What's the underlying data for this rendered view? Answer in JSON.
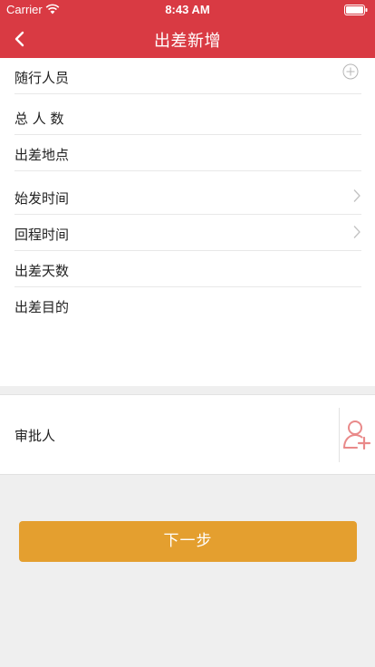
{
  "status_bar": {
    "carrier": "Carrier",
    "time": "8:43 AM",
    "wifi_icon": "wifi-icon",
    "battery_icon": "battery-icon"
  },
  "nav": {
    "title": "出差新增",
    "back_icon": "chevron-left-icon"
  },
  "form": {
    "fields": [
      {
        "label": "随行人员",
        "accessory": "plus-circle-icon"
      },
      {
        "label": "总 人 数",
        "accessory": ""
      },
      {
        "label": "出差地点",
        "accessory": ""
      },
      {
        "label": "始发时间",
        "accessory": "chevron-right-icon"
      },
      {
        "label": "回程时间",
        "accessory": "chevron-right-icon"
      },
      {
        "label": "出差天数",
        "accessory": ""
      },
      {
        "label": "出差目的",
        "accessory": ""
      }
    ]
  },
  "approver": {
    "label": "审批人",
    "add_icon": "add-user-icon"
  },
  "actions": {
    "next_label": "下一步"
  },
  "colors": {
    "header": "#d93a43",
    "button": "#e49f2f",
    "background": "#efefef",
    "add_user_icon": "#e98a8a"
  }
}
